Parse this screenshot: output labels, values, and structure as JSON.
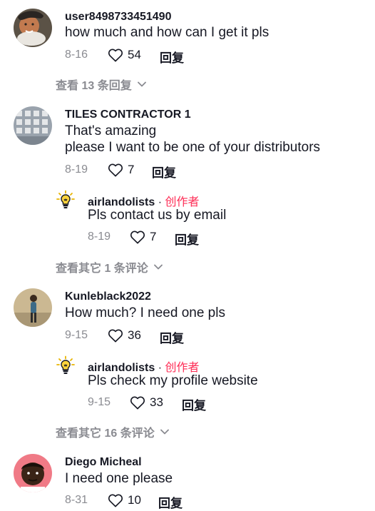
{
  "comments": [
    {
      "username": "user8498733451490",
      "text": [
        "how much and how can I get it pls"
      ],
      "date": "8-16",
      "likes": "54",
      "reply_label": "回复",
      "view_more": "查看 13 条回复"
    },
    {
      "username": "TILES CONTRACTOR 1",
      "text": [
        "That's amazing",
        "please I want to be one of your distributors"
      ],
      "date": "8-19",
      "likes": "7",
      "reply_label": "回复",
      "reply": {
        "username": "airlandolists",
        "author_sep": " · ",
        "author_tag": "创作者",
        "text": "Pls contact us by email",
        "date": "8-19",
        "likes": "7",
        "reply_label": "回复"
      },
      "view_more": "查看其它 1 条评论"
    },
    {
      "username": "Kunleblack2022",
      "text": [
        "How much? I need one pls"
      ],
      "date": "9-15",
      "likes": "36",
      "reply_label": "回复",
      "reply": {
        "username": "airlandolists",
        "author_sep": " · ",
        "author_tag": "创作者",
        "text": "Pls check my profile website",
        "date": "9-15",
        "likes": "33",
        "reply_label": "回复"
      },
      "view_more": "查看其它 16 条评论"
    },
    {
      "username": "Diego Micheal",
      "text": [
        "I need one please"
      ],
      "date": "8-31",
      "likes": "10",
      "reply_label": "回复"
    }
  ]
}
